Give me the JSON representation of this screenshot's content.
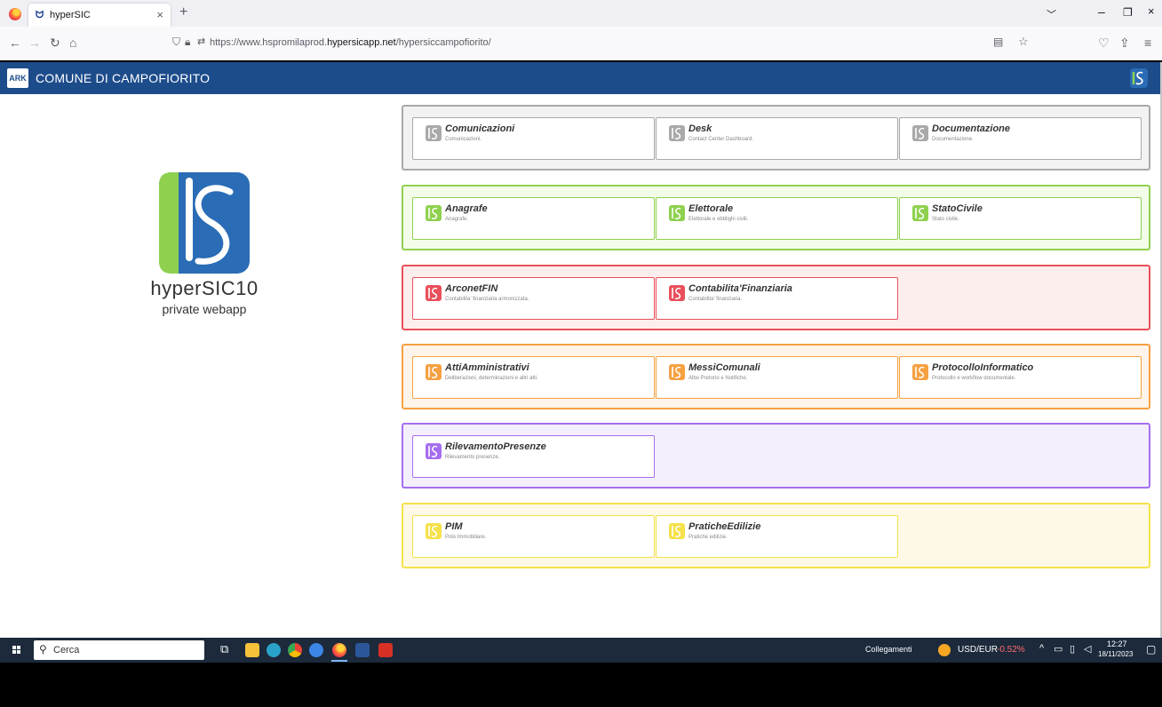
{
  "browser": {
    "tab_title": "hyperSIC",
    "tab_close": "×",
    "new_tab": "+",
    "url_prefix": "https://www.hspromilaprod.",
    "url_domain": "hypersicapp.net",
    "url_path": "/hypersiccampofiorito/"
  },
  "header": {
    "title": "COMUNE DI CAMPOFIORITO",
    "logo_text": "ARK"
  },
  "brand": {
    "name": "hyperSIC10",
    "subtitle": "private webapp"
  },
  "groups": [
    {
      "color": "#a9a9a9",
      "bg": "#f2f2f2",
      "cards": [
        {
          "name": "Comunicazioni",
          "desc": "Comunicazioni."
        },
        {
          "name": "Desk",
          "desc": "Contact Center Dashboard."
        },
        {
          "name": "Documentazione",
          "desc": "Documentazione."
        }
      ]
    },
    {
      "color": "#8fd14f",
      "bg": "#f3fbe9",
      "cards": [
        {
          "name": "Anagrafe",
          "desc": "Anagrafe."
        },
        {
          "name": "Elettorale",
          "desc": "Elettorale e obblighi civili."
        },
        {
          "name": "StatoCivile",
          "desc": "Stato civile."
        }
      ]
    },
    {
      "color": "#e8505b",
      "bg": "#fdeeee",
      "cards": [
        {
          "name": "ArconetFIN",
          "desc": "Contabilita' finanziaria armonizzata."
        },
        {
          "name": "Contabilita'Finanziaria",
          "desc": "Contabilita' finanziaria."
        }
      ]
    },
    {
      "color": "#f5a142",
      "bg": "#fef4ea",
      "cards": [
        {
          "name": "AttiAmministrativi",
          "desc": "Deliberazioni, determinazioni e altri atti."
        },
        {
          "name": "MessiComunali",
          "desc": "Albo Pretorio e Notifiche."
        },
        {
          "name": "ProtocolloInformatico",
          "desc": "Protocollo e workflow documentale."
        }
      ]
    },
    {
      "color": "#a56ef0",
      "bg": "#f4effd",
      "cards": [
        {
          "name": "RilevamentoPresenze",
          "desc": "Rilevamento presenze."
        }
      ]
    },
    {
      "color": "#f5e14a",
      "bg": "#fdf9e6",
      "cards": [
        {
          "name": "PIM",
          "desc": "Polo Immobiliare."
        },
        {
          "name": "PraticheEdilizie",
          "desc": "Pratiche edilizie."
        }
      ]
    }
  ],
  "taskbar": {
    "search_placeholder": "Cerca",
    "links_label": "Collegamenti",
    "ticker_pair": "USD/EUR",
    "ticker_change": "-0.52%",
    "time": "12:27",
    "date": "18/11/2023"
  }
}
